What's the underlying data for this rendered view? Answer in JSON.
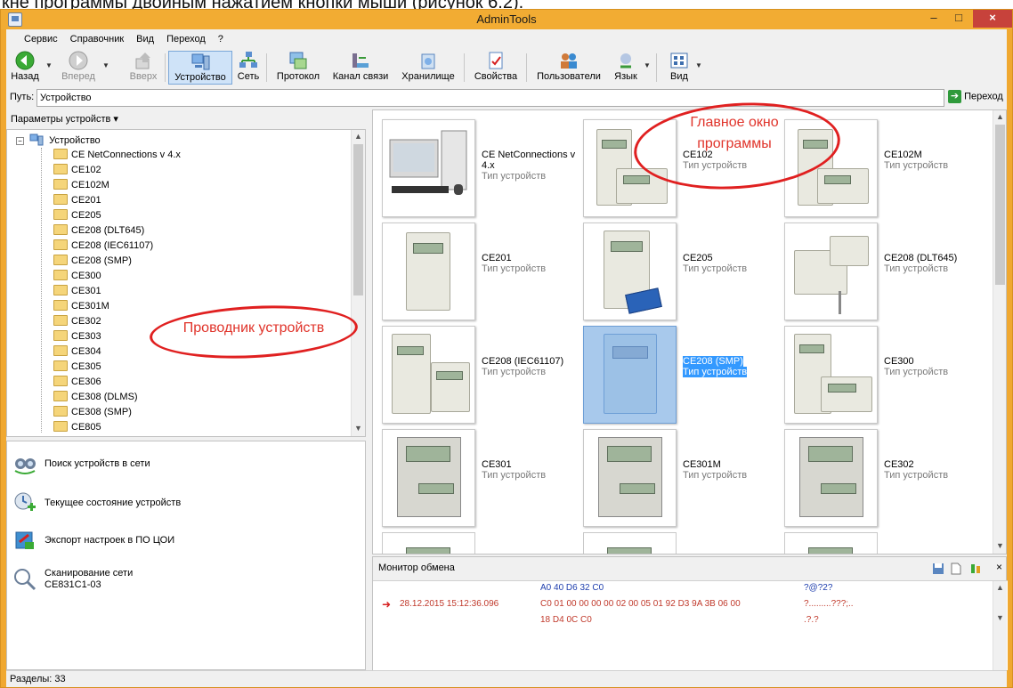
{
  "caption": "кне программы двойным нажатием кнопки мыши (рисунок 6.2).",
  "window": {
    "title": "AdminTools",
    "min": "–",
    "max": "□",
    "close": "×"
  },
  "menu": [
    "Сервис",
    "Справочник",
    "Вид",
    "Переход",
    "?"
  ],
  "toolbar": {
    "back": "Назад",
    "forward": "Вперед",
    "up": "Вверх",
    "device": "Устройство",
    "network": "Сеть",
    "protocol": "Протокол",
    "channel": "Канал связи",
    "storage": "Хранилище",
    "properties": "Свойства",
    "users": "Пользователи",
    "language": "Язык",
    "view": "Вид"
  },
  "path": {
    "label": "Путь:",
    "value": "Устройство",
    "go": "Переход"
  },
  "tree": {
    "header": "Параметры устройств ▾",
    "root": "Устройство",
    "items": [
      "CE NetConnections v 4.x",
      "CE102",
      "CE102M",
      "CE201",
      "CE205",
      "CE208 (DLT645)",
      "CE208 (IEC61107)",
      "CE208 (SMP)",
      "CE300",
      "CE301",
      "CE301M",
      "CE302",
      "CE303",
      "CE304",
      "CE305",
      "CE306",
      "CE308 (DLMS)",
      "CE308 (SMP)",
      "CE805"
    ]
  },
  "tasks": [
    {
      "label": "Поиск устройств в сети",
      "sub": ""
    },
    {
      "label": "Текущее состояние устройств",
      "sub": ""
    },
    {
      "label": "Экспорт настроек в ПО ЦОИ",
      "sub": ""
    },
    {
      "label": "Сканирование сети",
      "sub": "CE831C1-03"
    }
  ],
  "devices": [
    {
      "name": "CE NetConnections v 4.x",
      "type": "Тип устройств"
    },
    {
      "name": "CE102",
      "type": "Тип устройств"
    },
    {
      "name": "CE102M",
      "type": "Тип устройств"
    },
    {
      "name": "CE201",
      "type": "Тип устройств"
    },
    {
      "name": "CE205",
      "type": "Тип устройств"
    },
    {
      "name": "CE208 (DLT645)",
      "type": "Тип устройств"
    },
    {
      "name": "CE208 (IEC61107)",
      "type": "Тип устройств"
    },
    {
      "name": "CE208 (SMP)",
      "type": "Тип устройств"
    },
    {
      "name": "CE300",
      "type": "Тип устройств"
    },
    {
      "name": "CE301",
      "type": "Тип устройств"
    },
    {
      "name": "CE301M",
      "type": "Тип устройств"
    },
    {
      "name": "CE302",
      "type": "Тип устройств"
    }
  ],
  "monitor": {
    "title": "Монитор обмена",
    "close": "×",
    "hex_line1": "A0 40 D6 32 C0",
    "hex_line2": "C0 01 00 00 00 00 02 00 05 01 92 D3 9A 3B 06 00",
    "hex_line3": "18 D4 0C C0",
    "timestamp": "28.12.2015 15:12:36.096",
    "ascii_line1": "?@?2?",
    "ascii_line2": "?.........???;..",
    "ascii_line3": ".?.?"
  },
  "status": {
    "sections": "Разделы: 33"
  },
  "annotations": {
    "main_window": "Главное окно программы",
    "device_explorer": "Проводник устройств"
  },
  "colors": {
    "titlebar": "#f2ac33",
    "close_button": "#c7423b",
    "selection": "#3399ff",
    "annotation": "#e0332a",
    "arrow": "#d62020"
  }
}
